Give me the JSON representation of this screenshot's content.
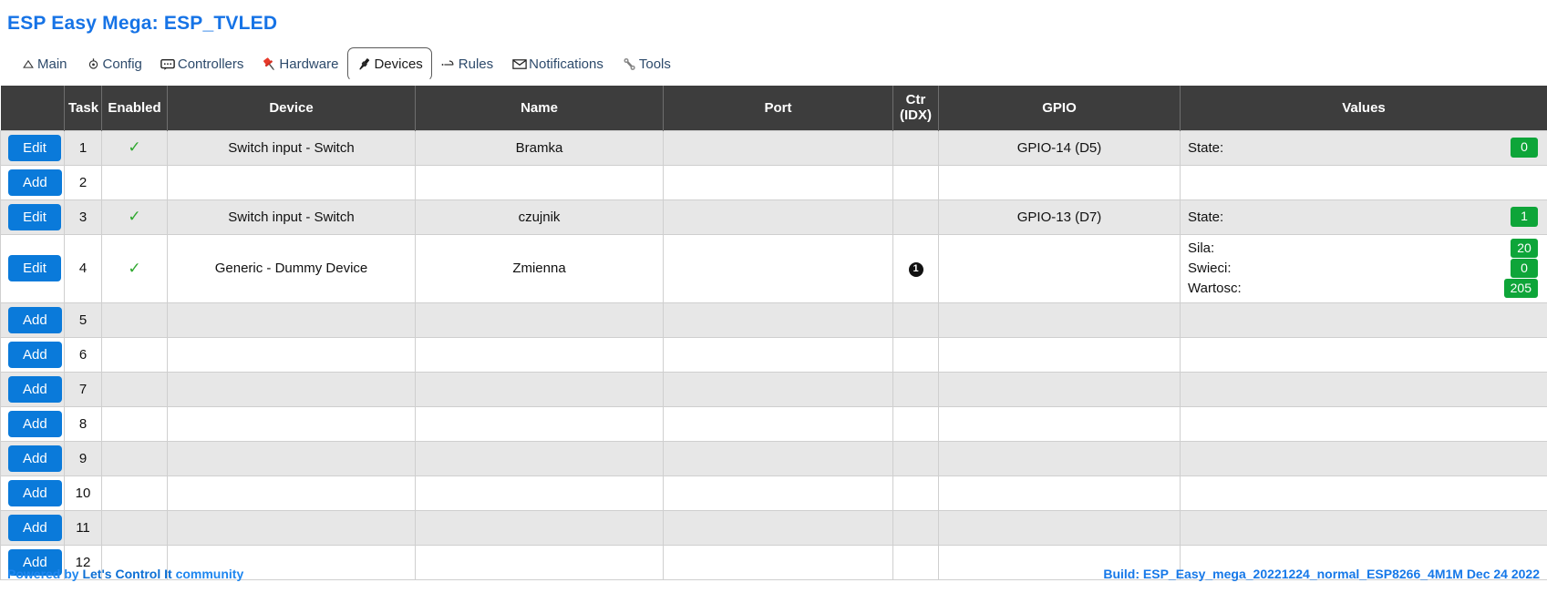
{
  "header": {
    "title": "ESP Easy Mega: ESP_TVLED"
  },
  "tabs": [
    {
      "label": "Main",
      "icon": "home-icon",
      "active": false
    },
    {
      "label": "Config",
      "icon": "gear-icon",
      "active": false
    },
    {
      "label": "Controllers",
      "icon": "speech-bubble-icon",
      "active": false
    },
    {
      "label": "Hardware",
      "icon": "pushpin-icon",
      "active": false
    },
    {
      "label": "Devices",
      "icon": "plug-icon",
      "active": true
    },
    {
      "label": "Rules",
      "icon": "arrow-icon",
      "active": false
    },
    {
      "label": "Notifications",
      "icon": "envelope-icon",
      "active": false
    },
    {
      "label": "Tools",
      "icon": "wrench-icon",
      "active": false
    }
  ],
  "table": {
    "columns": [
      "",
      "Task",
      "Enabled",
      "Device",
      "Name",
      "Port",
      "Ctr\n(IDX)",
      "GPIO",
      "Values"
    ],
    "headers": {
      "action": "",
      "task": "Task",
      "enabled": "Enabled",
      "device": "Device",
      "name": "Name",
      "port": "Port",
      "ctr_line1": "Ctr",
      "ctr_line2": "(IDX)",
      "gpio": "GPIO",
      "values": "Values"
    },
    "rows": [
      {
        "action": "Edit",
        "task": "1",
        "enabled": "✓",
        "device": "Switch input - Switch",
        "name": "Bramka",
        "port": "",
        "ctr": "",
        "gpio": "GPIO-14 (D5)",
        "values": [
          {
            "label": "State:",
            "value": "0"
          }
        ]
      },
      {
        "action": "Add",
        "task": "2",
        "enabled": "",
        "device": "",
        "name": "",
        "port": "",
        "ctr": "",
        "gpio": "",
        "values": []
      },
      {
        "action": "Edit",
        "task": "3",
        "enabled": "✓",
        "device": "Switch input - Switch",
        "name": "czujnik",
        "port": "",
        "ctr": "",
        "gpio": "GPIO-13 (D7)",
        "values": [
          {
            "label": "State:",
            "value": "1"
          }
        ]
      },
      {
        "action": "Edit",
        "task": "4",
        "enabled": "✓",
        "device": "Generic - Dummy Device",
        "name": "Zmienna",
        "port": "",
        "ctr": "1",
        "gpio": "",
        "values": [
          {
            "label": "Sila:",
            "value": "20"
          },
          {
            "label": "Swieci:",
            "value": "0"
          },
          {
            "label": "Wartosc:",
            "value": "205"
          }
        ]
      },
      {
        "action": "Add",
        "task": "5",
        "enabled": "",
        "device": "",
        "name": "",
        "port": "",
        "ctr": "",
        "gpio": "",
        "values": []
      },
      {
        "action": "Add",
        "task": "6",
        "enabled": "",
        "device": "",
        "name": "",
        "port": "",
        "ctr": "",
        "gpio": "",
        "values": []
      },
      {
        "action": "Add",
        "task": "7",
        "enabled": "",
        "device": "",
        "name": "",
        "port": "",
        "ctr": "",
        "gpio": "",
        "values": []
      },
      {
        "action": "Add",
        "task": "8",
        "enabled": "",
        "device": "",
        "name": "",
        "port": "",
        "ctr": "",
        "gpio": "",
        "values": []
      },
      {
        "action": "Add",
        "task": "9",
        "enabled": "",
        "device": "",
        "name": "",
        "port": "",
        "ctr": "",
        "gpio": "",
        "values": []
      },
      {
        "action": "Add",
        "task": "10",
        "enabled": "",
        "device": "",
        "name": "",
        "port": "",
        "ctr": "",
        "gpio": "",
        "values": []
      },
      {
        "action": "Add",
        "task": "11",
        "enabled": "",
        "device": "",
        "name": "",
        "port": "",
        "ctr": "",
        "gpio": "",
        "values": []
      },
      {
        "action": "Add",
        "task": "12",
        "enabled": "",
        "device": "",
        "name": "",
        "port": "",
        "ctr": "",
        "gpio": "",
        "values": []
      }
    ]
  },
  "footer": {
    "powered_prefix": "Powered by ",
    "powered_brand": "Let's Control It",
    "powered_suffix": " community",
    "build": "Build: ESP_Easy_mega_20221224_normal_ESP8266_4M1M Dec 24 2022"
  },
  "colors": {
    "accent_blue": "#1673e6",
    "button_blue": "#0a7ada",
    "header_dark": "#3d3d3d",
    "badge_green": "#0ea539",
    "check_green": "#2fa82f",
    "row_alt": "#e7e7e7",
    "pin_red": "#e8392a"
  }
}
